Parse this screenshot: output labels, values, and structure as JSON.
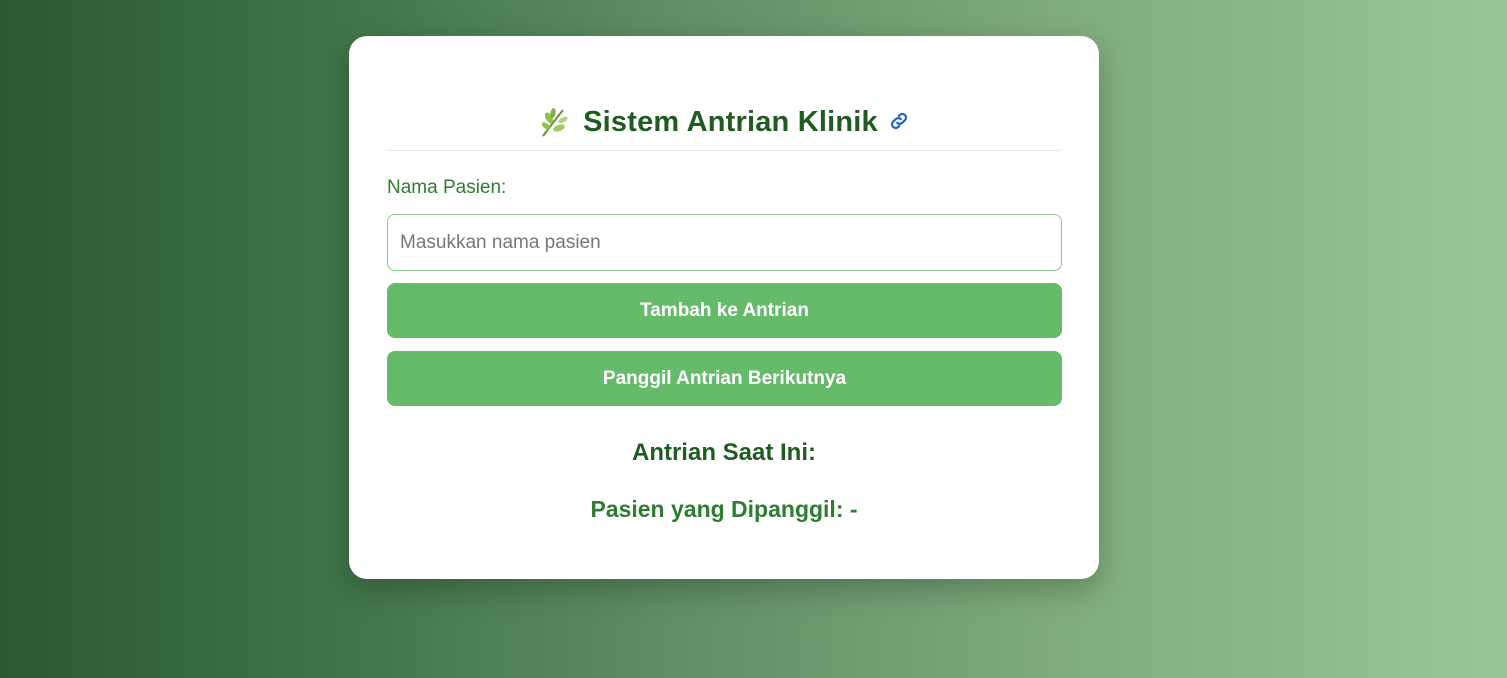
{
  "header": {
    "title": "Sistem Antrian Klinik",
    "leaf_icon": "herb-icon",
    "link_icon": "link-icon"
  },
  "form": {
    "label": "Nama Pasien:",
    "input_placeholder": "Masukkan nama pasien",
    "input_value": ""
  },
  "buttons": {
    "add_label": "Tambah ke Antrian",
    "call_label": "Panggil Antrian Berikutnya"
  },
  "queue": {
    "heading": "Antrian Saat Ini:",
    "called_prefix": "Pasien yang Dipanggil:",
    "called_value": "-"
  },
  "colors": {
    "accent": "#66bb6a",
    "title": "#1e5c22",
    "text_green": "#2e7d32"
  }
}
